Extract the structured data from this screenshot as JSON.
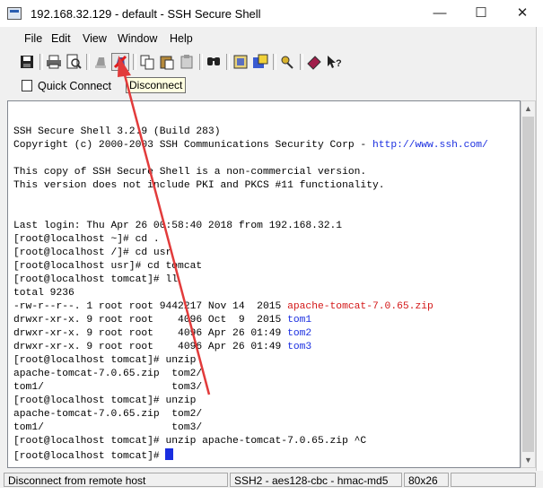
{
  "window": {
    "title": "192.168.32.129 - default - SSH Secure Shell",
    "controls": {
      "minimize": "—",
      "maximize": "☐",
      "close": "✕"
    }
  },
  "menu": [
    "File",
    "Edit",
    "View",
    "Window",
    "Help"
  ],
  "toolbar": {
    "buttons": [
      "save-icon",
      "print-icon",
      "print-preview-icon",
      "connect-icon",
      "disconnect-icon",
      "copy-icon",
      "paste-icon",
      "paste-clipboard-icon",
      "find-icon",
      "settings-icon",
      "profile-icon",
      "keys-icon",
      "help-book-icon",
      "context-help-icon"
    ]
  },
  "quick_connect": {
    "label": "Quick Connect"
  },
  "tooltip": {
    "text": "Disconnect"
  },
  "terminal": {
    "lines": [
      {
        "segments": [
          {
            "text": ""
          }
        ]
      },
      {
        "segments": [
          {
            "text": "SSH Secure Shell 3.2.9 (Build 283)"
          }
        ]
      },
      {
        "segments": [
          {
            "text": "Copyright (c) 2000-2003 SSH Communications Security Corp - "
          },
          {
            "text": "http://www.ssh.com/",
            "color": "#1a2ee0"
          }
        ]
      },
      {
        "segments": [
          {
            "text": ""
          }
        ]
      },
      {
        "segments": [
          {
            "text": "This copy of SSH Secure Shell is a non-commercial version."
          }
        ]
      },
      {
        "segments": [
          {
            "text": "This version does not include PKI and PKCS #11 functionality."
          }
        ]
      },
      {
        "segments": [
          {
            "text": ""
          }
        ]
      },
      {
        "segments": [
          {
            "text": ""
          }
        ]
      },
      {
        "segments": [
          {
            "text": "Last login: Thu Apr 26 00:58:40 2018 from 192.168.32.1"
          }
        ]
      },
      {
        "segments": [
          {
            "text": "[root@localhost ~]# cd ."
          }
        ]
      },
      {
        "segments": [
          {
            "text": "[root@localhost /]# cd usr"
          }
        ]
      },
      {
        "segments": [
          {
            "text": "[root@localhost usr]# cd tomcat"
          }
        ]
      },
      {
        "segments": [
          {
            "text": "[root@localhost tomcat]# ll"
          }
        ]
      },
      {
        "segments": [
          {
            "text": "total 9236"
          }
        ]
      },
      {
        "segments": [
          {
            "text": "-rw-r--r--. 1 root root 9442217 Nov 14  2015 "
          },
          {
            "text": "apache-tomcat-7.0.65.zip",
            "color": "#d31616"
          }
        ]
      },
      {
        "segments": [
          {
            "text": "drwxr-xr-x. 9 root root    4096 Oct  9  2015 "
          },
          {
            "text": "tom1",
            "color": "#1a2ee0"
          }
        ]
      },
      {
        "segments": [
          {
            "text": "drwxr-xr-x. 9 root root    4096 Apr 26 01:49 "
          },
          {
            "text": "tom2",
            "color": "#1a2ee0"
          }
        ]
      },
      {
        "segments": [
          {
            "text": "drwxr-xr-x. 9 root root    4096 Apr 26 01:49 "
          },
          {
            "text": "tom3",
            "color": "#1a2ee0"
          }
        ]
      },
      {
        "segments": [
          {
            "text": "[root@localhost tomcat]# unzip"
          }
        ]
      },
      {
        "segments": [
          {
            "text": "apache-tomcat-7.0.65.zip  tom2/"
          }
        ]
      },
      {
        "segments": [
          {
            "text": "tom1/                     tom3/"
          }
        ]
      },
      {
        "segments": [
          {
            "text": "[root@localhost tomcat]# unzip"
          }
        ]
      },
      {
        "segments": [
          {
            "text": "apache-tomcat-7.0.65.zip  tom2/"
          }
        ]
      },
      {
        "segments": [
          {
            "text": "tom1/                     tom3/"
          }
        ]
      },
      {
        "segments": [
          {
            "text": "[root@localhost tomcat]# unzip apache-tomcat-7.0.65.zip ^C"
          }
        ]
      },
      {
        "segments": [
          {
            "text": "[root@localhost tomcat]# "
          }
        ],
        "cursor": true
      }
    ]
  },
  "status": {
    "message": "Disconnect from remote host",
    "cipher": "SSH2 - aes128-cbc - hmac-md5",
    "size": "80x26"
  },
  "colors": {
    "link_blue": "#1a2ee0",
    "archive_red": "#d31616",
    "annotation_arrow": "#e23b3b"
  }
}
